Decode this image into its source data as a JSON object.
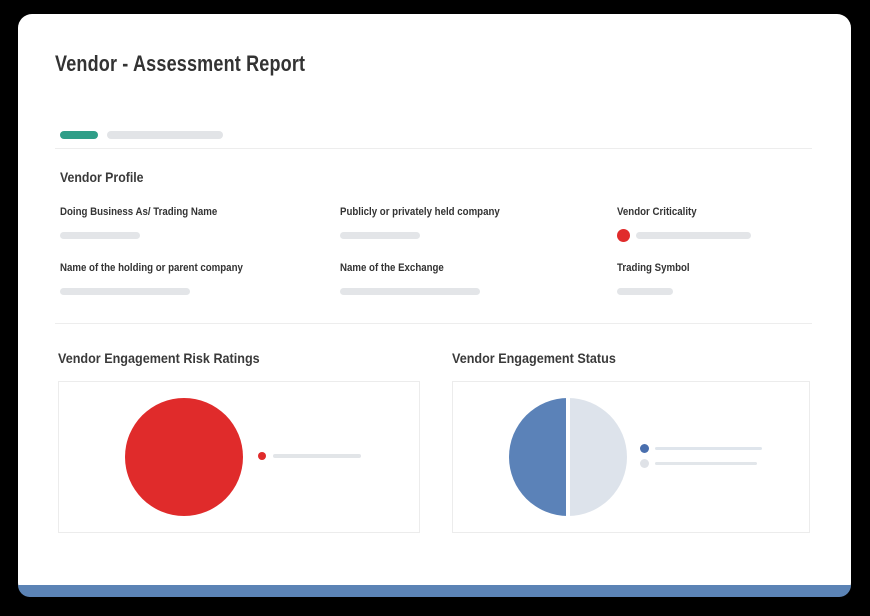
{
  "window": {
    "title": "Vendor - Assessment Report"
  },
  "theme": {
    "accent_teal": "#2f9e88",
    "skeleton_gray": "#e3e5e8",
    "footer_blue": "#5b83b5",
    "criticality_red": "#e02b2b",
    "text_dark": "#333333"
  },
  "stepper": {
    "steps": [
      {
        "name": "step-1",
        "state": "active",
        "color": "#2f9e88"
      },
      {
        "name": "step-2",
        "state": "upcoming",
        "color": "#e2e4e7"
      }
    ]
  },
  "profile": {
    "heading": "Vendor Profile",
    "fields": [
      {
        "label": "Doing Business As/ Trading Name",
        "value": ""
      },
      {
        "label": "Publicly or privately held company",
        "value": ""
      },
      {
        "label": "Vendor Criticality",
        "value": "",
        "indicator_color": "#e02b2b"
      },
      {
        "label": "Name of the holding or parent company",
        "value": ""
      },
      {
        "label": "Name of the Exchange",
        "value": ""
      },
      {
        "label": "Trading Symbol",
        "value": ""
      }
    ]
  },
  "charts": {
    "risk_ratings_heading": "Vendor Engagement Risk Ratings",
    "status_heading": "Vendor Engagement Status"
  },
  "chart_data": [
    {
      "type": "pie",
      "title": "Vendor Engagement Risk Ratings",
      "slices": [
        {
          "label": "",
          "value": 100,
          "color": "#e02b2b"
        }
      ],
      "legend": {
        "position": "right",
        "entries": [
          {
            "swatch_color": "#e02b2b",
            "label": ""
          }
        ]
      },
      "data_labels_visible": false
    },
    {
      "type": "pie",
      "title": "Vendor Engagement Status",
      "slices": [
        {
          "label": "",
          "value": 50,
          "color": "#5b82b8"
        },
        {
          "label": "",
          "value": 50,
          "color": "#dde3eb"
        }
      ],
      "legend": {
        "position": "right",
        "entries": [
          {
            "swatch_color": "#4a6fae",
            "label": ""
          },
          {
            "swatch_color": "#dfe2e7",
            "label": ""
          }
        ]
      },
      "data_labels_visible": false
    }
  ]
}
